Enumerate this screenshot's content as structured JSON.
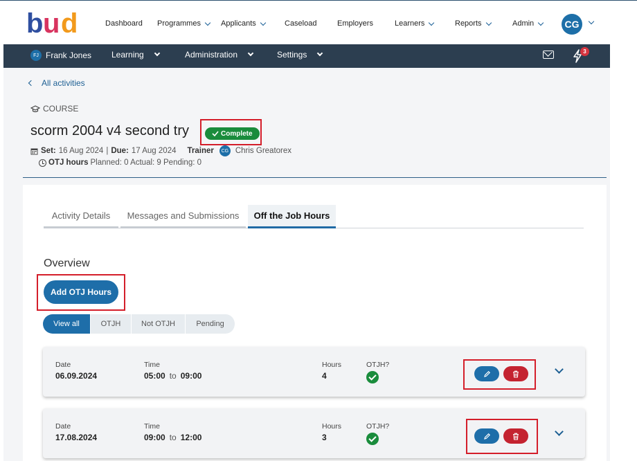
{
  "app": {
    "logo_text": "bud",
    "user_initials": "CG"
  },
  "topnav": {
    "items": [
      "Dashboard",
      "Programmes",
      "Applicants",
      "Caseload",
      "Employers",
      "Learners",
      "Reports",
      "Admin"
    ]
  },
  "subnav": {
    "learner_initials": "FJ",
    "learner_name": "Frank Jones",
    "items": [
      "Learning",
      "Administration",
      "Settings"
    ],
    "notification_count": "3"
  },
  "header": {
    "back_label": "All activities",
    "type_label": "COURSE",
    "title": "scorm 2004 v4 second try",
    "status": "Complete",
    "set_label": "Set:",
    "set_value": "16 Aug 2024",
    "due_label": "Due:",
    "due_value": "17 Aug 2024",
    "trainer_label": "Trainer",
    "trainer_initials": "CG",
    "trainer_name": "Chris Greatorex",
    "otj_label": "OTJ hours",
    "otj_summary": "Planned: 0 Actual: 9 Pending: 0"
  },
  "tabs": [
    "Activity Details",
    "Messages and Submissions",
    "Off the Job Hours"
  ],
  "overview": {
    "title": "Overview",
    "add_button": "Add OTJ Hours",
    "filters": [
      "View all",
      "OTJH",
      "Not OTJH",
      "Pending"
    ],
    "columns": {
      "date": "Date",
      "time": "Time",
      "hours": "Hours",
      "otjh": "OTJH?"
    },
    "to_word": "to",
    "rows": [
      {
        "date": "06.09.2024",
        "start": "05:00",
        "end": "09:00",
        "hours": "4",
        "otjh": true
      },
      {
        "date": "17.08.2024",
        "start": "09:00",
        "end": "12:00",
        "hours": "3",
        "otjh": true
      }
    ]
  }
}
